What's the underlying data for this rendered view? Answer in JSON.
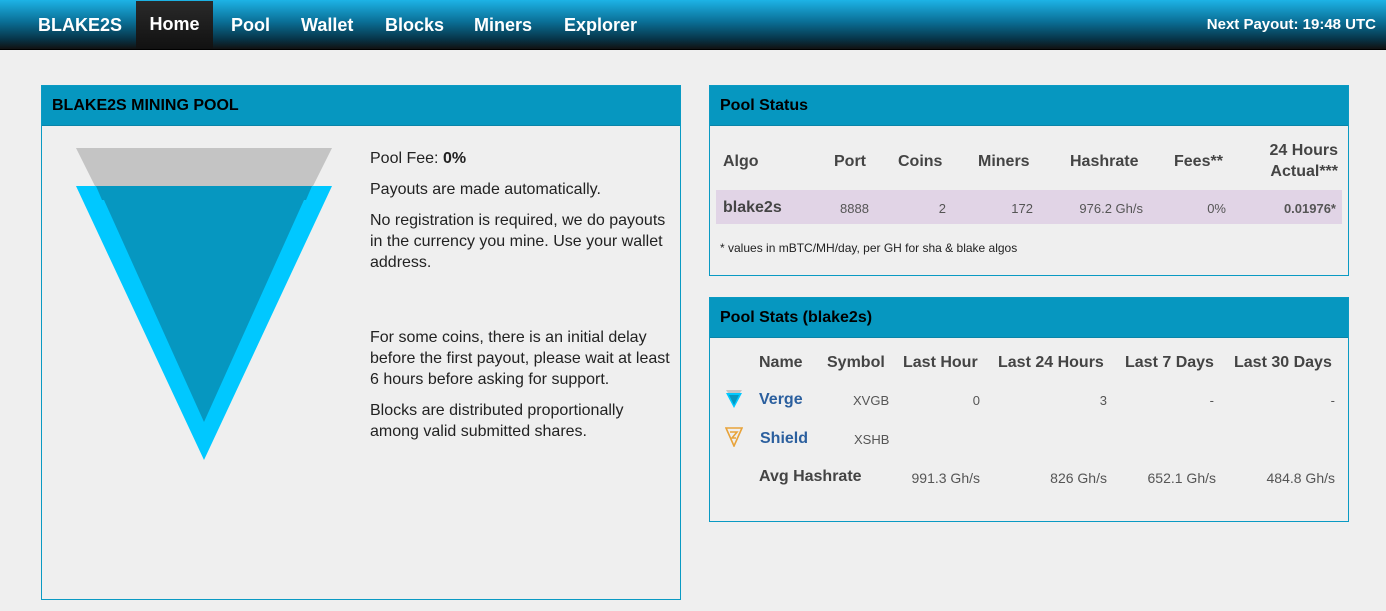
{
  "nav": {
    "brand": "BLAKE2S",
    "items": [
      "Home",
      "Pool",
      "Wallet",
      "Blocks",
      "Miners",
      "Explorer"
    ],
    "next_payout": "Next Payout: 19:48 UTC"
  },
  "intro": {
    "title": "BLAKE2S MINING POOL",
    "fee_label": "Pool Fee:",
    "fee_value": "0%",
    "p1": "Payouts are made automatically.",
    "p2": "No registration is required, we do payouts in the currency you mine. Use your wallet address.",
    "p3": "For some coins, there is an initial delay before the first payout, please wait at least 6 hours before asking for support.",
    "p4": "Blocks are distributed proportionally among valid submitted shares."
  },
  "status": {
    "title": "Pool Status",
    "headers": {
      "algo": "Algo",
      "port": "Port",
      "coins": "Coins",
      "miners": "Miners",
      "hashrate": "Hashrate",
      "fees": "Fees**",
      "actual_1": "24 Hours",
      "actual_2": "Actual***"
    },
    "row": {
      "algo": "blake2s",
      "port": "8888",
      "coins": "2",
      "miners": "172",
      "hashrate": "976.2 Gh/s",
      "fees": "0%",
      "actual": "0.01976*"
    },
    "note": "* values in mBTC/MH/day, per GH for sha & blake algos"
  },
  "stats": {
    "title": "Pool Stats (blake2s)",
    "headers": {
      "name": "Name",
      "symbol": "Symbol",
      "h1": "Last Hour",
      "h24": "Last 24 Hours",
      "d7": "Last 7 Days",
      "d30": "Last 30 Days"
    },
    "rows": [
      {
        "name": "Verge",
        "symbol": "XVGB",
        "h1": "0",
        "h24": "3",
        "d7": "-",
        "d30": "-"
      },
      {
        "name": "Shield",
        "symbol": "XSHB",
        "h1": "",
        "h24": "",
        "d7": "",
        "d30": ""
      }
    ],
    "avg": {
      "label": "Avg Hashrate",
      "h1": "991.3 Gh/s",
      "h24": "826 Gh/s",
      "d7": "652.1 Gh/s",
      "d30": "484.8 Gh/s"
    }
  },
  "colors": {
    "accent": "#0697c0",
    "verge": "#00c8ff",
    "shield": "#e8a33a",
    "highlight": "#e1d4e6"
  }
}
